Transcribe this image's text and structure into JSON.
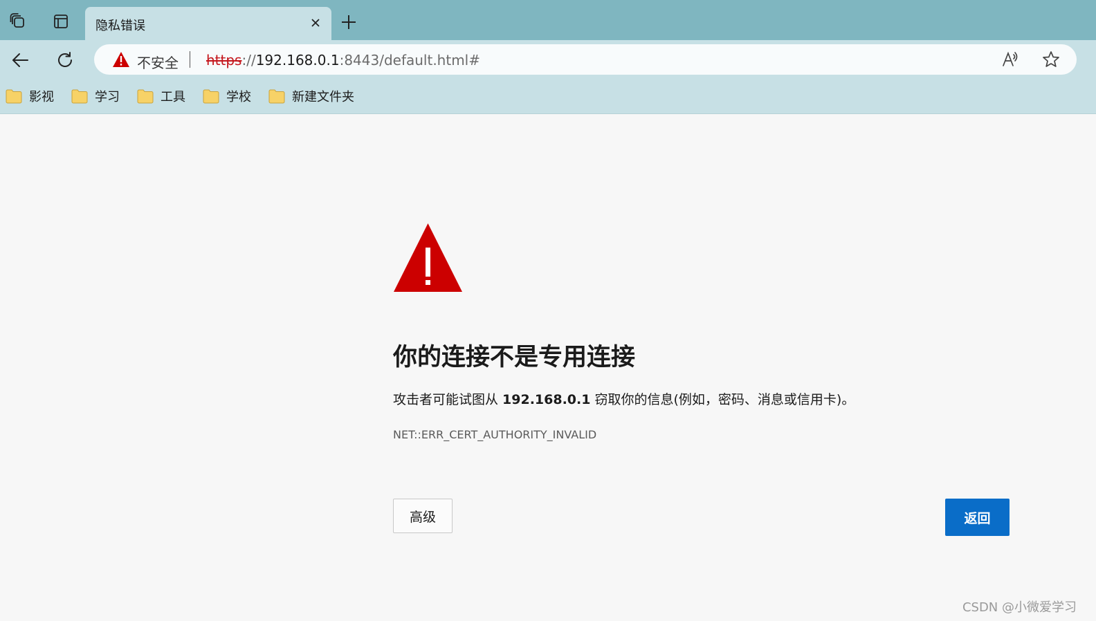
{
  "browser": {
    "tab": {
      "title": "隐私错误",
      "close_icon": "close-icon"
    },
    "new_tab_icon": "plus-icon",
    "workspaces_icon": "workspaces-icon",
    "tab_actions_icon": "tab-actions-icon"
  },
  "toolbar": {
    "back_icon": "back-arrow-icon",
    "refresh_icon": "refresh-icon",
    "security_label": "不安全",
    "url_scheme": "https",
    "url_separator": "://",
    "url_host": "192.168.0.1",
    "url_rest": ":8443/default.html#",
    "read_aloud_icon": "read-aloud-icon",
    "favorite_icon": "star-icon"
  },
  "bookmarks": [
    {
      "label": "影视"
    },
    {
      "label": "学习"
    },
    {
      "label": "工具"
    },
    {
      "label": "学校"
    },
    {
      "label": "新建文件夹"
    }
  ],
  "page": {
    "heading": "你的连接不是专用连接",
    "desc_prefix": "攻击者可能试图从 ",
    "desc_host": "192.168.0.1",
    "desc_suffix": " 窃取你的信息(例如，密码、消息或信用卡)。",
    "error_code": "NET::ERR_CERT_AUTHORITY_INVALID",
    "advanced_label": "高级",
    "back_label": "返回"
  },
  "watermark": "CSDN @小微爱学习",
  "colors": {
    "warning_red": "#cc0000",
    "primary_button": "#0a6dc8",
    "titlebar": "#7fb6c0",
    "toolbar": "#c7e0e5"
  }
}
